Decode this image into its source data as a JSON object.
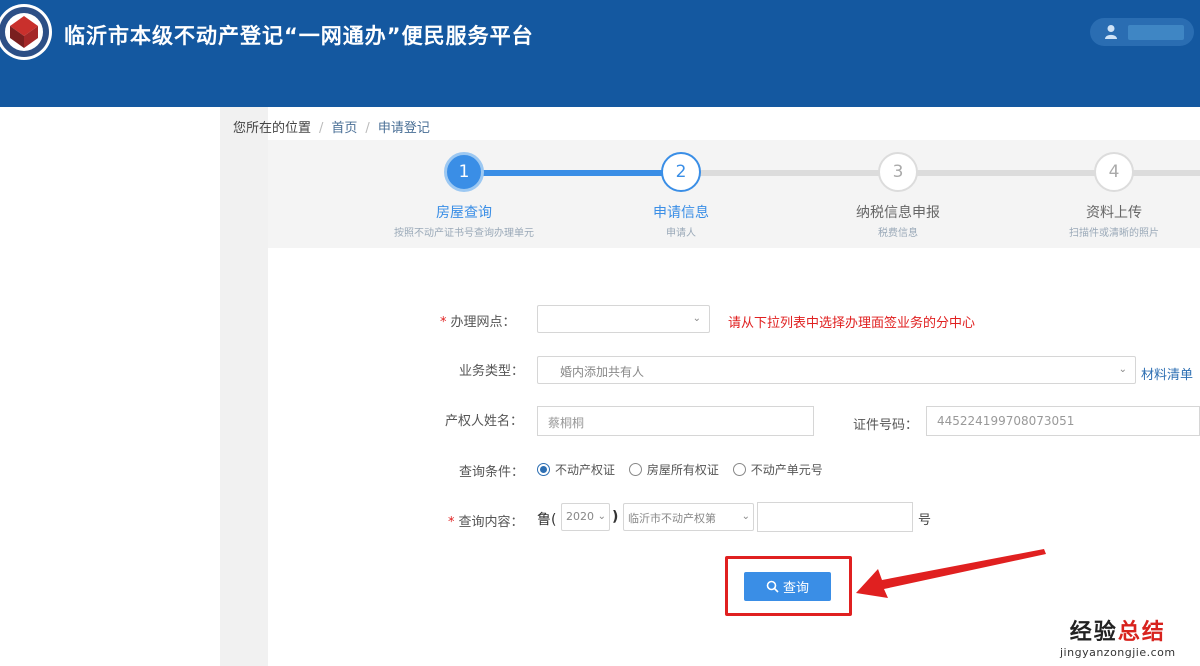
{
  "header": {
    "title": "临沂市本级不动产登记“一网通办”便民服务平台",
    "user_name": ""
  },
  "breadcrumb": {
    "prefix": "您所在的位置",
    "items": [
      "首页",
      "申请登记"
    ]
  },
  "steps": [
    {
      "number": "1",
      "title": "房屋查询",
      "subtitle": "按照不动产证书号查询办理单元",
      "status": "done"
    },
    {
      "number": "2",
      "title": "申请信息",
      "subtitle": "申请人",
      "status": "current"
    },
    {
      "number": "3",
      "title": "纳税信息申报",
      "subtitle": "税费信息",
      "status": "pending"
    },
    {
      "number": "4",
      "title": "资料上传",
      "subtitle": "扫描件或清晰的照片",
      "status": "pending"
    }
  ],
  "form": {
    "outlet_label": "办理网点：",
    "outlet_value": "",
    "outlet_hint": "请从下拉列表中选择办理面签业务的分中心",
    "business_type_label": "业务类型：",
    "business_type_value": "婚内添加共有人",
    "materials_link": "材料清单",
    "owner_name_label": "产权人姓名：",
    "owner_name_value": "蔡桐桐",
    "id_number_label": "证件号码：",
    "id_number_value": "445224199708073051",
    "condition_label": "查询条件：",
    "condition_options": [
      "不动产权证",
      "房屋所有权证",
      "不动产单元号"
    ],
    "condition_selected": "不动产权证",
    "content_label": "查询内容：",
    "content_prefix": "鲁(",
    "content_year": "2020",
    "content_paren_close": ")",
    "content_city": "临沂市不动产权第",
    "content_number": "",
    "content_suffix": "号",
    "query_button": "查询"
  },
  "watermark": {
    "main_left": "经验",
    "main_right": "总结",
    "sub": "jingyanzongjie.com"
  },
  "colors": {
    "header_bg": "#1458a0",
    "accent": "#3a8ee6",
    "required": "#e02020",
    "highlight": "#e02020"
  }
}
